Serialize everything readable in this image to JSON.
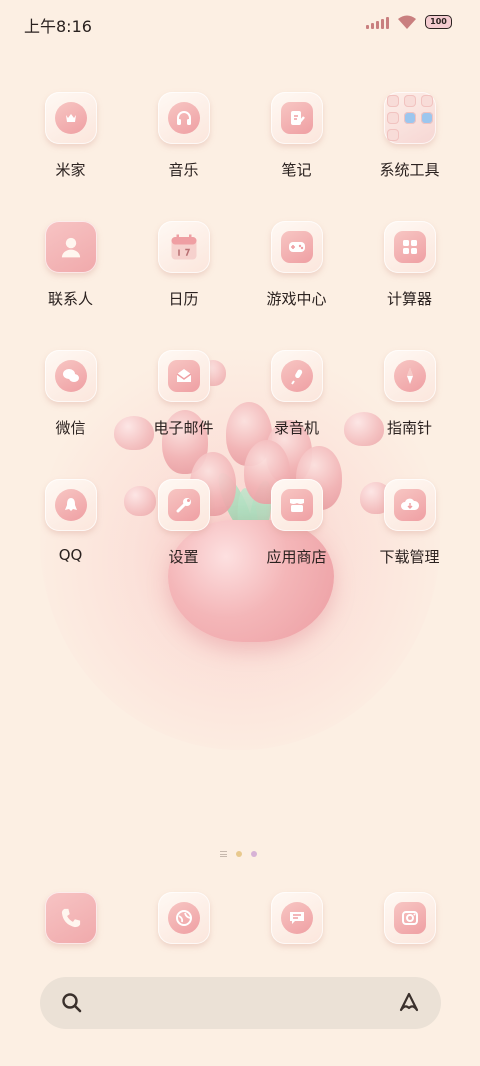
{
  "status_bar": {
    "time": "上午8:16",
    "battery": "100"
  },
  "apps": [
    [
      {
        "id": "mijia",
        "label": "米家",
        "icon": "crown-face-icon"
      },
      {
        "id": "music",
        "label": "音乐",
        "icon": "headphones-icon"
      },
      {
        "id": "notes",
        "label": "笔记",
        "icon": "note-pen-icon"
      },
      {
        "id": "system-tools",
        "label": "系统工具",
        "icon": "folder-icon"
      }
    ],
    [
      {
        "id": "contacts",
        "label": "联系人",
        "icon": "person-icon"
      },
      {
        "id": "calendar",
        "label": "日历",
        "icon": "calendar-icon"
      },
      {
        "id": "game-center",
        "label": "游戏中心",
        "icon": "gamepad-icon"
      },
      {
        "id": "calculator",
        "label": "计算器",
        "icon": "calculator-icon"
      }
    ],
    [
      {
        "id": "wechat",
        "label": "微信",
        "icon": "chat-bubbles-icon"
      },
      {
        "id": "email",
        "label": "电子邮件",
        "icon": "envelope-icon"
      },
      {
        "id": "recorder",
        "label": "录音机",
        "icon": "microphone-icon"
      },
      {
        "id": "compass",
        "label": "指南针",
        "icon": "compass-icon"
      }
    ],
    [
      {
        "id": "qq",
        "label": "QQ",
        "icon": "penguin-icon"
      },
      {
        "id": "settings",
        "label": "设置",
        "icon": "wrench-icon"
      },
      {
        "id": "app-store",
        "label": "应用商店",
        "icon": "store-icon"
      },
      {
        "id": "downloads",
        "label": "下载管理",
        "icon": "cloud-download-icon"
      }
    ]
  ],
  "dock": [
    {
      "id": "phone",
      "icon": "phone-icon"
    },
    {
      "id": "browser",
      "icon": "globe-icon"
    },
    {
      "id": "messages",
      "icon": "message-icon"
    },
    {
      "id": "camera",
      "icon": "camera-icon"
    }
  ],
  "search": {
    "icon": "search-icon",
    "assistant_icon": "assistant-icon",
    "placeholder": ""
  },
  "colors": {
    "background": "#fcefe3",
    "accent": "#ef9fa3",
    "search_bar": "#ebe1d6"
  }
}
